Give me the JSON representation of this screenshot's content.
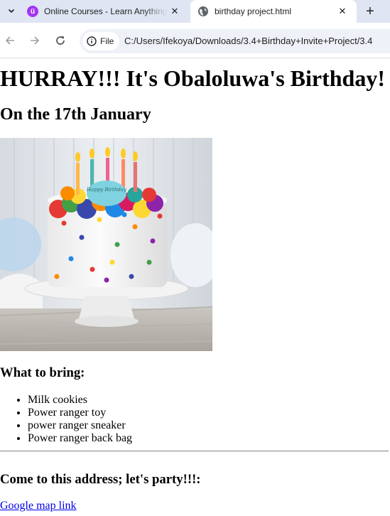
{
  "browser": {
    "tabs": [
      {
        "title": "Online Courses - Learn Anything",
        "favicon": "udemy-icon",
        "active": false
      },
      {
        "title": "birthday project.html",
        "favicon": "globe-icon",
        "active": true
      }
    ],
    "address_bar": {
      "chip_label": "File",
      "url": "C:/Users/Ifekoya/Downloads/3.4+Birthday+Invite+Project/3.4"
    },
    "icons": {
      "tab_menu": "chevron-down-icon",
      "close": "close-icon",
      "new_tab": "plus-icon",
      "back": "back-arrow-icon",
      "forward": "forward-arrow-icon",
      "reload": "reload-icon",
      "info": "info-icon"
    }
  },
  "page": {
    "heading": "HURRAY!!! It's Obaloluwa's Birthday!",
    "date_heading": "On the 17th January",
    "cake_image": {
      "topper_text": "Happy Birthday"
    },
    "bring_heading": "What to bring:",
    "bring_items": [
      "Milk cookies",
      "Power ranger toy",
      "power ranger sneaker",
      "Power ranger back bag"
    ],
    "address_heading": "Come to this address; let's party!!!:",
    "map_link": "Google map link"
  },
  "colors": {
    "tabstrip_bg": "#dfe5f3",
    "omnibox_bg": "#eef1f7",
    "udemy_purple": "#a435f0",
    "link_blue": "#0000ee"
  }
}
